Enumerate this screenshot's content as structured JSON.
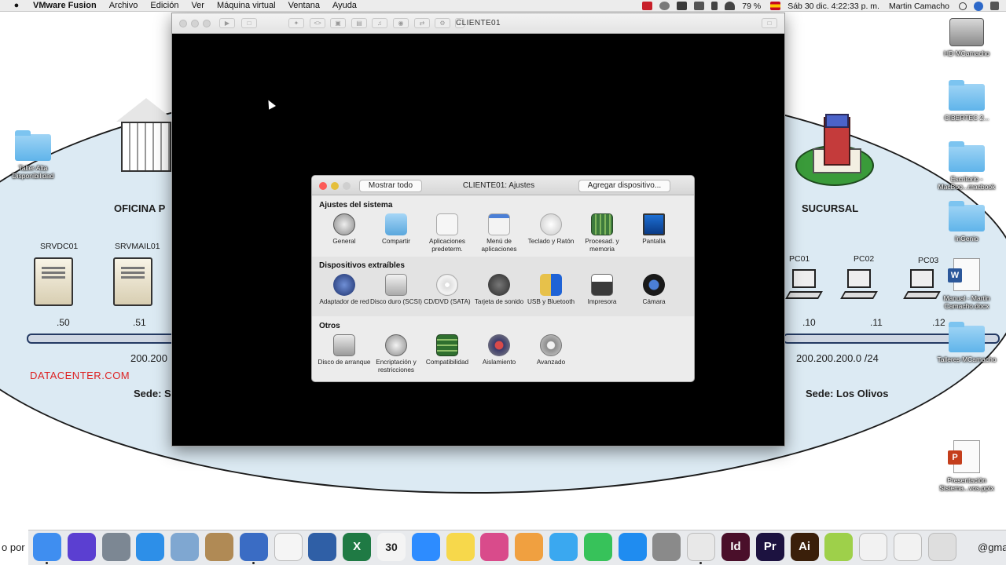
{
  "menubar": {
    "app_name": "VMware Fusion",
    "menus": [
      "Archivo",
      "Edición",
      "Ver",
      "Máquina virtual",
      "Ventana",
      "Ayuda"
    ],
    "battery": "79 %",
    "datetime": "Sáb 30 dic.  4:22:33 p. m.",
    "user": "Martin Camacho"
  },
  "diagram": {
    "left_building_label": "OFICINA P",
    "right_building_label": "SUCURSAL",
    "servers": [
      {
        "name": "SRVDC01",
        "ip": ".50"
      },
      {
        "name": "SRVMAIL01",
        "ip": ".51"
      }
    ],
    "pcs": [
      {
        "name": "PC01",
        "ip": ".10"
      },
      {
        "name": "PC02",
        "ip": ".11"
      },
      {
        "name": "PC03",
        "ip": ".12"
      }
    ],
    "left_network": "200.200",
    "right_network": "200.200.200.0 /24",
    "datacenter": "DATACENTER.COM",
    "left_site": "Sede: S",
    "right_site": "Sede: Los Olivos"
  },
  "desktop_icons": {
    "left_folder": "Taller Alta Disponibilidad",
    "right": [
      {
        "label": "HD MCamacho",
        "kind": "hdd"
      },
      {
        "label": "CIBERTEC 2...",
        "kind": "folder"
      },
      {
        "label": "Escritorio - MacBoo...macbook",
        "kind": "folder"
      },
      {
        "label": "InGenio",
        "kind": "folder"
      },
      {
        "label": "Manual - Martin Camacho.docx",
        "kind": "word"
      },
      {
        "label": "Talleres MCamacho",
        "kind": "folder"
      },
      {
        "label": "Presentación Sistema...vos.pptx",
        "kind": "ppt"
      }
    ]
  },
  "vm_window": {
    "title": "CLIENTE01"
  },
  "settings_dialog": {
    "show_all_label": "Mostrar todo",
    "title": "CLIENTE01: Ajustes",
    "add_device_label": "Agregar dispositivo...",
    "sections": [
      {
        "heading": "Ajustes del sistema",
        "items": [
          {
            "label": "General",
            "icon": "general-switch-icon"
          },
          {
            "label": "Compartir",
            "icon": "shared-folder-icon"
          },
          {
            "label": "Aplicaciones predeterm.",
            "icon": "default-apps-icon"
          },
          {
            "label": "Menú de aplicaciones",
            "icon": "app-menu-icon"
          },
          {
            "label": "Teclado y Ratón",
            "icon": "keyboard-mouse-icon"
          },
          {
            "label": "Procesad. y memoria",
            "icon": "processor-memory-icon"
          },
          {
            "label": "Pantalla",
            "icon": "display-icon"
          }
        ]
      },
      {
        "heading": "Dispositivos extraíbles",
        "items": [
          {
            "label": "Adaptador de red",
            "icon": "network-adapter-icon"
          },
          {
            "label": "Disco duro (SCSI)",
            "icon": "hard-disk-icon"
          },
          {
            "label": "CD/DVD (SATA)",
            "icon": "cd-dvd-icon"
          },
          {
            "label": "Tarjeta de sonido",
            "icon": "speaker-icon"
          },
          {
            "label": "USB y Bluetooth",
            "icon": "usb-bluetooth-icon"
          },
          {
            "label": "Impresora",
            "icon": "printer-icon"
          },
          {
            "label": "Cámara",
            "icon": "camera-icon"
          }
        ]
      },
      {
        "heading": "Otros",
        "items": [
          {
            "label": "Disco de arranque",
            "icon": "startup-disk-icon"
          },
          {
            "label": "Encriptación y restricciones",
            "icon": "encryption-lock-icon"
          },
          {
            "label": "Compatibilidad",
            "icon": "compatibility-board-icon"
          },
          {
            "label": "Aislamiento",
            "icon": "isolation-icon"
          },
          {
            "label": "Avanzado",
            "icon": "advanced-gear-icon"
          }
        ]
      }
    ]
  },
  "dock": {
    "left_text": "o por",
    "right_text": "@gma",
    "calendar_day": "30",
    "items": [
      {
        "name": "finder",
        "color": "#3f8ef0",
        "glyph": ""
      },
      {
        "name": "siri",
        "color": "#5b3fd1",
        "glyph": ""
      },
      {
        "name": "launchpad",
        "color": "#7c8793",
        "glyph": ""
      },
      {
        "name": "safari",
        "color": "#2d8fe8",
        "glyph": ""
      },
      {
        "name": "preview",
        "color": "#7fa7d1",
        "glyph": ""
      },
      {
        "name": "contacts",
        "color": "#b08a55",
        "glyph": ""
      },
      {
        "name": "vmware-fusion",
        "color": "#3a6cc4",
        "glyph": ""
      },
      {
        "name": "google-drive",
        "color": "#f5f5f5",
        "glyph": ""
      },
      {
        "name": "virtualbox",
        "color": "#2f5fa6",
        "glyph": ""
      },
      {
        "name": "excel",
        "color": "#1f7a44",
        "glyph": "X"
      },
      {
        "name": "calendar",
        "color": "#f4f4f4",
        "glyph": ""
      },
      {
        "name": "zoom",
        "color": "#2d8cff",
        "glyph": ""
      },
      {
        "name": "notes",
        "color": "#f7d84b",
        "glyph": ""
      },
      {
        "name": "screen-sharing",
        "color": "#d94b8b",
        "glyph": ""
      },
      {
        "name": "photos",
        "color": "#f0a040",
        "glyph": ""
      },
      {
        "name": "messages",
        "color": "#3aa8f0",
        "glyph": ""
      },
      {
        "name": "facetime",
        "color": "#37c25a",
        "glyph": ""
      },
      {
        "name": "app-store",
        "color": "#1f8cf0",
        "glyph": ""
      },
      {
        "name": "system-preferences",
        "color": "#8a8a8a",
        "glyph": ""
      },
      {
        "name": "chrome",
        "color": "#e8e8e8",
        "glyph": ""
      },
      {
        "name": "indesign",
        "color": "#4a0f2a",
        "glyph": "Id"
      },
      {
        "name": "premiere",
        "color": "#1c1240",
        "glyph": "Pr"
      },
      {
        "name": "illustrator",
        "color": "#3a1f0a",
        "glyph": "Ai"
      },
      {
        "name": "camtasia",
        "color": "#9ed04a",
        "glyph": ""
      },
      {
        "name": "downloads-stack",
        "color": "#f2f2f2",
        "glyph": ""
      },
      {
        "name": "documents-stack",
        "color": "#f2f2f2",
        "glyph": ""
      },
      {
        "name": "trash",
        "color": "#dedede",
        "glyph": ""
      }
    ]
  }
}
